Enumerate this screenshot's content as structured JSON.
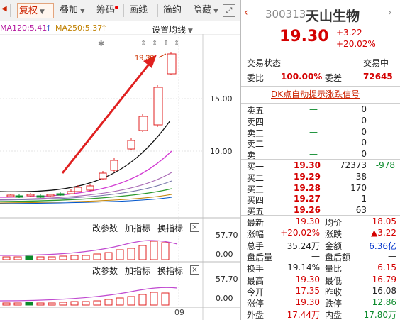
{
  "toolbar": {
    "restore_label": "复权",
    "overlay_label": "叠加",
    "picker_label": "筹码",
    "draw_label": "画线",
    "simple_label": "简约",
    "hide_label": "隐藏"
  },
  "ma_legend": {
    "ma120": "MA120:5.41",
    "ma250": "MA250:5.37",
    "set_ma_label": "设置均线"
  },
  "chart": {
    "price_label": "19.30",
    "y_ticks": [
      "15.00",
      "10.00"
    ],
    "x_label": "09"
  },
  "indicator1": {
    "edit_label": "改参数",
    "add_label": "加指标",
    "switch_label": "换指标",
    "close_label": "×",
    "y_top": "57.70",
    "y_bottom": "0.00"
  },
  "indicator2": {
    "edit_label": "改参数",
    "add_label": "加指标",
    "switch_label": "换指标",
    "close_label": "×",
    "y_top": "57.70",
    "y_bottom": "0.00"
  },
  "quote": {
    "code": "300313",
    "name": "天山生物",
    "price": "19.30",
    "change": "+3.22",
    "change_pct": "+20.02%",
    "status_label": "交易状态",
    "status_value": "交易中",
    "commission_ratio_label": "委比",
    "commission_ratio_value": "100.00%",
    "commission_diff_label": "委差",
    "commission_diff_value": "72645",
    "dk_link": "DK点自动提示涨跌信号",
    "asks": [
      {
        "label": "卖五",
        "price": "—",
        "volume": "0"
      },
      {
        "label": "卖四",
        "price": "—",
        "volume": "0"
      },
      {
        "label": "卖三",
        "price": "—",
        "volume": "0"
      },
      {
        "label": "卖二",
        "price": "—",
        "volume": "0"
      },
      {
        "label": "卖一",
        "price": "—",
        "volume": "0"
      }
    ],
    "bids": [
      {
        "label": "买一",
        "price": "19.30",
        "volume": "72373",
        "delta": "-978"
      },
      {
        "label": "买二",
        "price": "19.29",
        "volume": "38",
        "delta": ""
      },
      {
        "label": "买三",
        "price": "19.28",
        "volume": "170",
        "delta": ""
      },
      {
        "label": "买四",
        "price": "19.27",
        "volume": "1",
        "delta": ""
      },
      {
        "label": "买五",
        "price": "19.26",
        "volume": "63",
        "delta": ""
      }
    ],
    "stats": [
      {
        "l1": "最新",
        "v1": "19.30",
        "c1": "red",
        "l2": "均价",
        "v2": "18.05",
        "c2": "red"
      },
      {
        "l1": "涨幅",
        "v1": "+20.02%",
        "c1": "red",
        "l2": "涨跌",
        "v2": "▲3.22",
        "c2": "red"
      },
      {
        "l1": "总手",
        "v1": "35.24万",
        "c1": "dark",
        "l2": "金额",
        "v2": "6.36亿",
        "c2": "blue"
      },
      {
        "l1": "盘后量",
        "v1": "—",
        "c1": "dark",
        "l2": "盘后额",
        "v2": "—",
        "c2": "dark"
      },
      {
        "l1": "换手",
        "v1": "19.14%",
        "c1": "dark",
        "l2": "量比",
        "v2": "6.15",
        "c2": "red"
      },
      {
        "l1": "最高",
        "v1": "19.30",
        "c1": "red",
        "l2": "最低",
        "v2": "16.79",
        "c2": "red"
      },
      {
        "l1": "今开",
        "v1": "17.35",
        "c1": "red",
        "l2": "昨收",
        "v2": "16.08",
        "c2": "dark"
      },
      {
        "l1": "涨停",
        "v1": "19.30",
        "c1": "red",
        "l2": "跌停",
        "v2": "12.86",
        "c2": "green"
      },
      {
        "l1": "外盘",
        "v1": "17.44万",
        "c1": "red",
        "l2": "内盘",
        "v2": "17.80万",
        "c2": "green"
      }
    ]
  },
  "colors": {
    "up": "#d40000",
    "down": "#0a8a2a",
    "accent": "#cc2200"
  }
}
